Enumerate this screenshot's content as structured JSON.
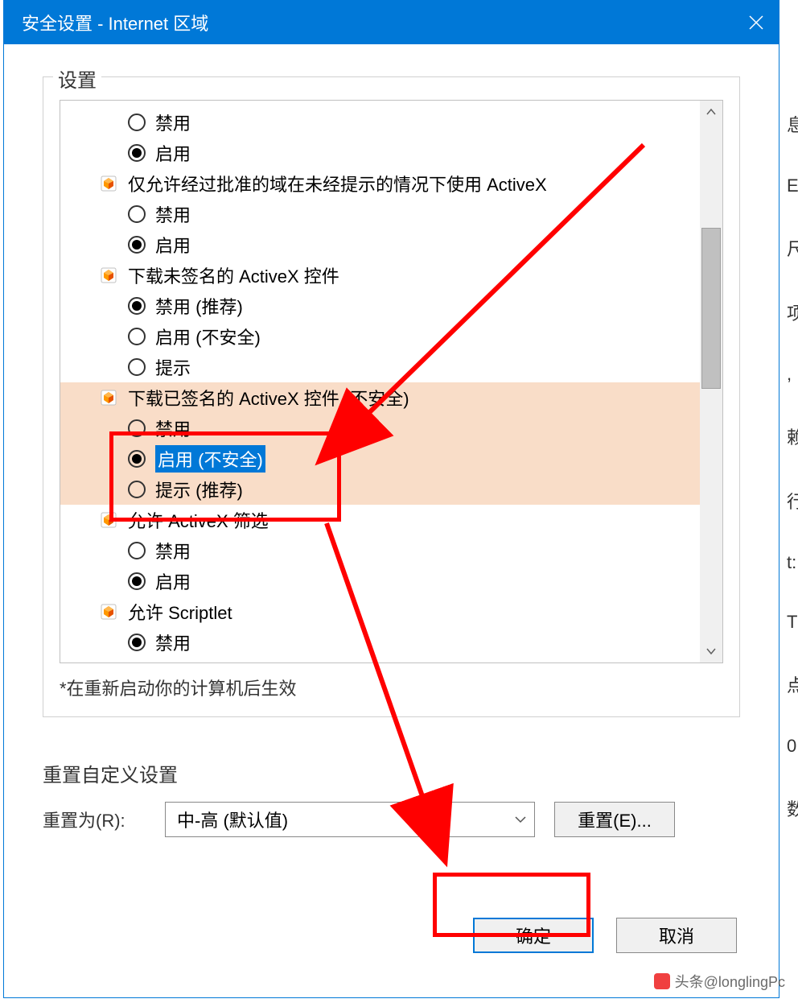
{
  "titlebar": {
    "title": "安全设置 - Internet 区域"
  },
  "groupbox": {
    "label": "设置"
  },
  "settings": {
    "items": [
      {
        "type": "option",
        "label": "禁用",
        "checked": false
      },
      {
        "type": "option",
        "label": "启用",
        "checked": true
      },
      {
        "type": "category",
        "icon": "activex",
        "label": "仅允许经过批准的域在未经提示的情况下使用 ActiveX"
      },
      {
        "type": "option",
        "label": "禁用",
        "checked": false
      },
      {
        "type": "option",
        "label": "启用",
        "checked": true
      },
      {
        "type": "category",
        "icon": "activex",
        "label": "下载未签名的 ActiveX 控件"
      },
      {
        "type": "option",
        "label": "禁用 (推荐)",
        "checked": true
      },
      {
        "type": "option",
        "label": "启用 (不安全)",
        "checked": false
      },
      {
        "type": "option",
        "label": "提示",
        "checked": false
      },
      {
        "type": "category",
        "icon": "activex",
        "label": "下载已签名的 ActiveX 控件 (不安全)",
        "highlighted": true
      },
      {
        "type": "option",
        "label": "禁用",
        "checked": false,
        "highlighted": true
      },
      {
        "type": "option",
        "label": "启用 (不安全)",
        "checked": true,
        "highlighted": true,
        "selected": true
      },
      {
        "type": "option",
        "label": "提示 (推荐)",
        "checked": false,
        "highlighted": true
      },
      {
        "type": "category",
        "icon": "activex",
        "label": "允许 ActiveX 筛选"
      },
      {
        "type": "option",
        "label": "禁用",
        "checked": false
      },
      {
        "type": "option",
        "label": "启用",
        "checked": true
      },
      {
        "type": "category",
        "icon": "activex",
        "label": "允许 Scriptlet"
      },
      {
        "type": "option",
        "label": "禁用",
        "checked": true
      }
    ],
    "note": "*在重新启动你的计算机后生效"
  },
  "reset": {
    "section_label": "重置自定义设置",
    "reset_to_label": "重置为(R):",
    "dropdown_value": "中-高 (默认值)",
    "reset_button": "重置(E)..."
  },
  "footer": {
    "ok": "确定",
    "cancel": "取消"
  },
  "side_chars": [
    "息",
    "E",
    "尺",
    "项",
    ",",
    "赖",
    "行",
    "t:",
    "T",
    "点",
    "0",
    "数"
  ],
  "watermark": "头条@longlingPc"
}
